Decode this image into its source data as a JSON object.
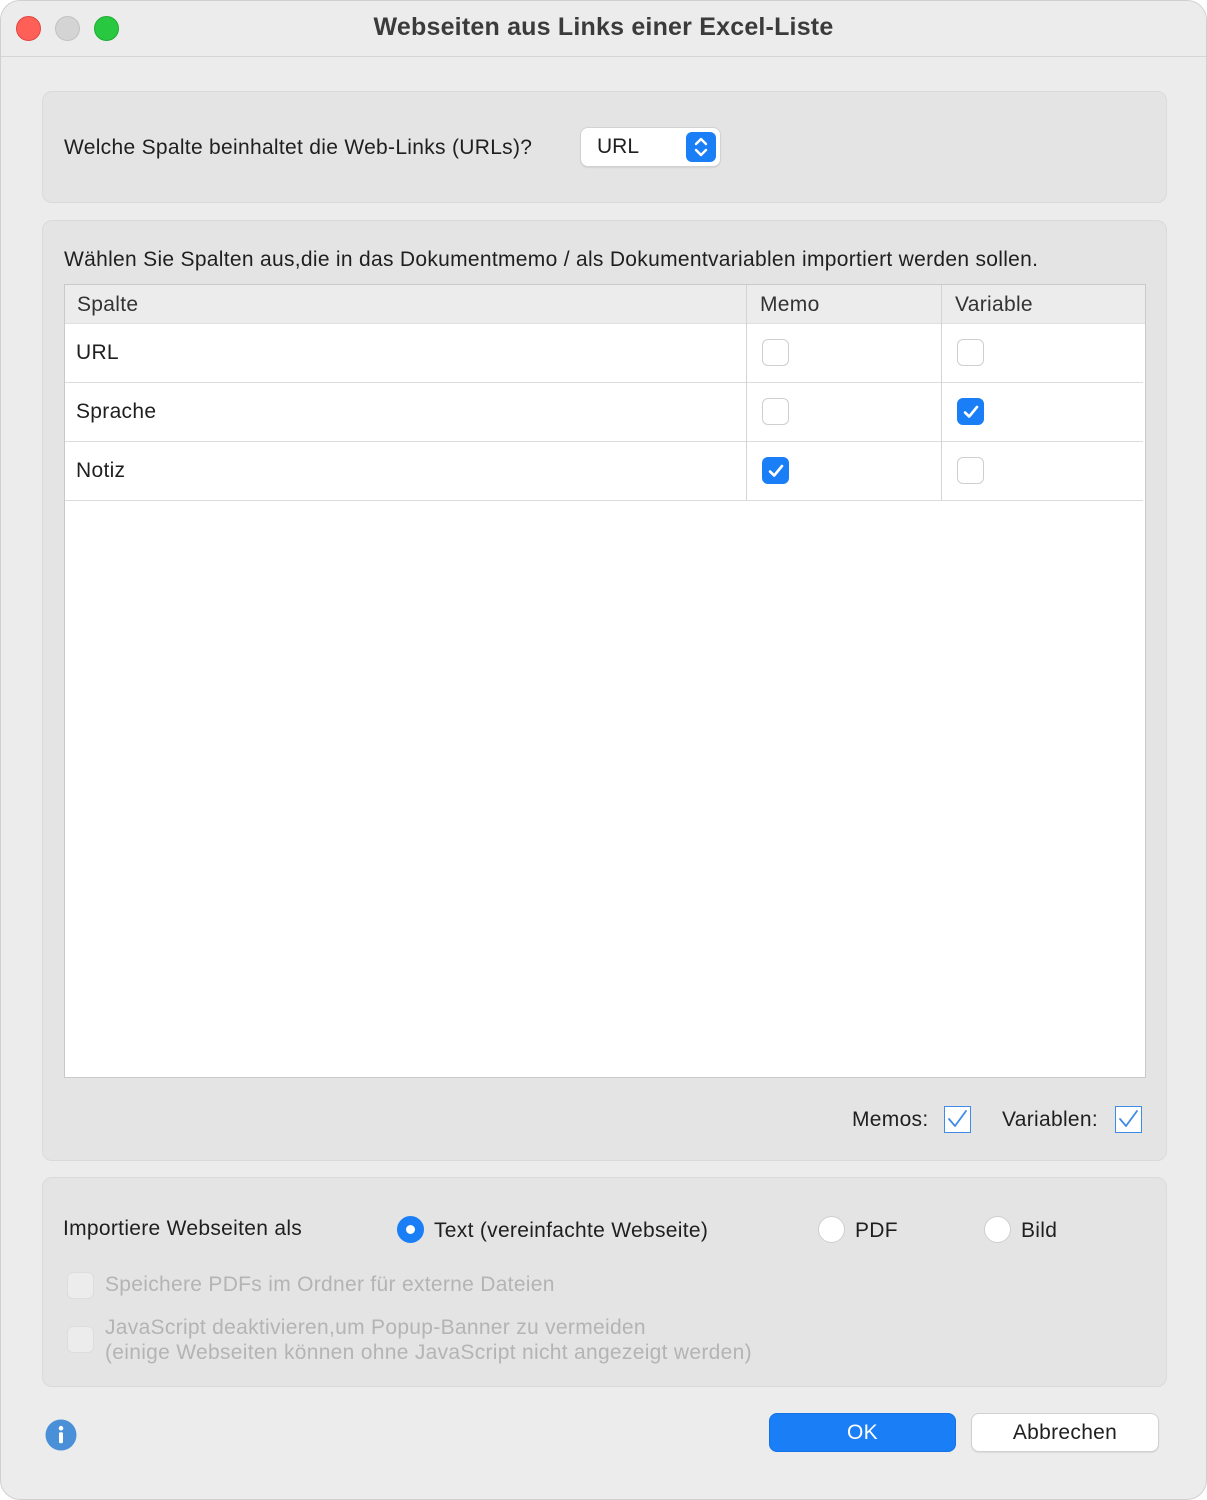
{
  "window": {
    "title": "Webseiten aus Links einer Excel-Liste"
  },
  "url_column": {
    "label": "Welche Spalte beinhaltet die Web-Links (URLs)?",
    "selected": "URL"
  },
  "columns_section": {
    "instruction": "Wählen Sie Spalten aus,die in das Dokumentmemo / als Dokumentvariablen importiert werden sollen.",
    "headers": [
      "Spalte",
      "Memo",
      "Variable"
    ],
    "rows": [
      {
        "name": "URL",
        "memo": false,
        "variable": false
      },
      {
        "name": "Sprache",
        "memo": false,
        "variable": true
      },
      {
        "name": "Notiz",
        "memo": true,
        "variable": false
      }
    ],
    "memos_label": "Memos:",
    "variables_label": "Variablen:",
    "memos_all": true,
    "variables_all": true
  },
  "import_section": {
    "label": "Importiere Webseiten als",
    "options": [
      "Text (vereinfachte Webseite)",
      "PDF",
      "Bild"
    ],
    "selected_index": 0,
    "save_pdfs_label": "Speichere PDFs im Ordner für externe Dateien",
    "js_label_line1": "JavaScript deaktivieren,um Popup-Banner zu vermeiden",
    "js_label_line2": "(einige Webseiten können ohne JavaScript nicht angezeigt werden)"
  },
  "buttons": {
    "ok": "OK",
    "cancel": "Abbrechen"
  },
  "colors": {
    "accent": "#1a7ef7",
    "close": "#fe5f57",
    "maximize": "#28c840",
    "info": "#4a90d9"
  }
}
